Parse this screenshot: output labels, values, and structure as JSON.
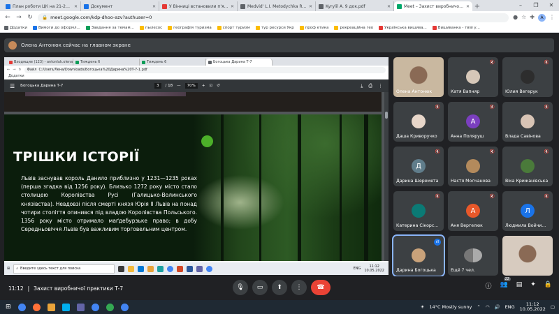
{
  "browser": {
    "tabs": [
      {
        "label": "План роботи ЦК на 21-22н.р.",
        "color": "#1a73e8",
        "active": false
      },
      {
        "label": "Документ",
        "color": "#1a73e8",
        "active": false
      },
      {
        "label": "У Вінниці встановили п'ять таб...",
        "color": "#e53935",
        "active": false
      },
      {
        "label": "Medvid' L.I. Metodychka RH_201...",
        "color": "#5f6368",
        "active": false
      },
      {
        "label": "Kyrylil A. 9 док.pdf",
        "color": "#5f6368",
        "active": false
      },
      {
        "label": "Meet – Захист виробничої...",
        "color": "#00a86b",
        "active": true
      }
    ],
    "new_tab": "+",
    "window_controls": [
      "–",
      "❐",
      "✕"
    ],
    "url": "meet.google.com/kdp-dhoo-azv?authuser=0",
    "profile_initial": "А",
    "bookmarks": [
      {
        "label": "Додатки",
        "color": "#5f6368"
      },
      {
        "label": "Вимоги до оформл...",
        "color": "#1a73e8"
      },
      {
        "label": "Завдання за темам...",
        "color": "#0f9d58"
      },
      {
        "label": "пылесос",
        "color": "#fbbc04"
      },
      {
        "label": "географія туризма",
        "color": "#fbbc04"
      },
      {
        "label": "спорт туризм",
        "color": "#fbbc04"
      },
      {
        "label": "тур ресурси Укр",
        "color": "#fbbc04"
      },
      {
        "label": "проф етика",
        "color": "#fbbc04"
      },
      {
        "label": "рекреаційна гео",
        "color": "#fbbc04"
      },
      {
        "label": "Українська вишива...",
        "color": "#e53935"
      },
      {
        "label": "Вишиванка - твій у...",
        "color": "#e53935"
      }
    ]
  },
  "meet": {
    "presenting_banner": "Олена Антонюк сейчас на главном экране",
    "time": "11:12",
    "meeting_title": "Захист виробничої практики Т-7",
    "participants_count": "22",
    "participants": [
      {
        "name": "Олена Антонюк",
        "initial": "",
        "color": "#c9b8a0",
        "mic_muted": false,
        "video": true
      },
      {
        "name": "Катя Вапняр",
        "initial": "",
        "color": "#d6c7b8",
        "mic_muted": true,
        "video": false
      },
      {
        "name": "Юлия Вегерук",
        "initial": "",
        "color": "#2d2d2d",
        "mic_muted": true,
        "video": false
      },
      {
        "name": "Даша Криворучко",
        "initial": "",
        "color": "#e7d6c9",
        "mic_muted": true,
        "video": false
      },
      {
        "name": "Анна Поляруш",
        "initial": "А",
        "color": "#7b3fbf",
        "mic_muted": true,
        "video": false
      },
      {
        "name": "Влада Савінова",
        "initial": "",
        "color": "#d8c4b5",
        "mic_muted": true,
        "video": false
      },
      {
        "name": "Дарина Шеремета",
        "initial": "Д",
        "color": "#607d8b",
        "mic_muted": true,
        "video": false
      },
      {
        "name": "Настя Молчанова",
        "initial": "",
        "color": "#b38a5c",
        "mic_muted": true,
        "video": false
      },
      {
        "name": "Віка Крижанівська",
        "initial": "",
        "color": "#4a7a3a",
        "mic_muted": true,
        "video": false
      },
      {
        "name": "Катерина Сікорс...",
        "initial": "",
        "color": "#0b7a75",
        "mic_muted": true,
        "video": false
      },
      {
        "name": "Аня Вергелюк",
        "initial": "А",
        "color": "#e8582a",
        "mic_muted": true,
        "video": false
      },
      {
        "name": "Людмила Войчи...",
        "initial": "Л",
        "color": "#1a73e8",
        "mic_muted": true,
        "video": false
      },
      {
        "name": "Дарина Богоцька",
        "initial": "",
        "color": "#c9a27a",
        "mic_muted": false,
        "video": false
      },
      {
        "name": "Ещё 7 чел.",
        "initial": "",
        "color": "#9aa0a6",
        "mic_muted": false,
        "video": false
      },
      {
        "name": "",
        "initial": "",
        "color": "#d7cbbf",
        "mic_muted": false,
        "video": true
      }
    ]
  },
  "shared": {
    "tabs": [
      {
        "label": "Входящие (123) - antonluk.olena...",
        "color": "#e53935"
      },
      {
        "label": "Тиждень 6",
        "color": "#0f9d58"
      },
      {
        "label": "Тиждень 6",
        "color": "#0f9d58"
      },
      {
        "label": "Богоцька Дарина Т-7",
        "color": "#5f6368"
      }
    ],
    "url_prefix": "Файл",
    "url": "C:/Users/Лена/Downloads/Богоцька%20Дарина%20T-7-1.pdf",
    "bookmarks": "Додатки",
    "pdf_title": "Богоцька Дарина Т-7",
    "page_current": "3",
    "page_total": "/ 18",
    "zoom": "70%",
    "slide_title": "ТРІШКИ ІСТОРІЇ",
    "slide_text": "Львів заснував король Данило приблизно у 1231—1235 роках (перша згадка від 1256 року). Близько 1272 року місто стало столицею Королівства Русі (Галицько-Волинського князівства). Невдовзі після смерті князя Юрія II Львів на понад чотири століття опинився під владою Королівства Польського. 1356 року місто отримало маґдебурзьке право; в добу Середньовіччя Львів був важливим торговельним центром.",
    "taskbar_search": "Введите здесь текст для поиска",
    "taskbar_lang": "ENG",
    "taskbar_time": "11:12",
    "taskbar_date": "10.05.2022"
  },
  "windows": {
    "weather": "14°C Mostly sunny",
    "lang": "ENG",
    "time": "11:12",
    "date": "10.05.2022"
  }
}
